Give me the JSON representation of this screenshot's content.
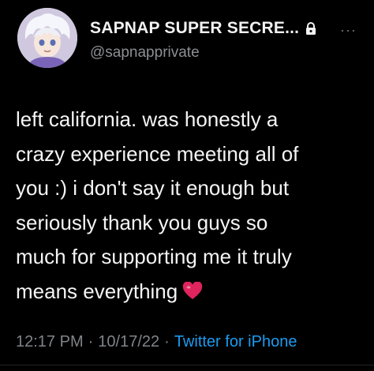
{
  "header": {
    "display_name": "SAPNAP SUPER SECRE...",
    "handle": "@sapnapprivate",
    "lock_icon": "lock-icon",
    "more_icon": "more-icon",
    "more_glyph": "···"
  },
  "tweet": {
    "text": "left california. was honestly a\ncrazy experience meeting all of\nyou :) i don't say it enough but\nseriously thank you guys so\nmuch for supporting me it truly\nmeans everything",
    "emoji": "heart-icon"
  },
  "meta": {
    "time": "12:17 PM",
    "date": "10/17/22",
    "separator": "·",
    "source": "Twitter for iPhone"
  },
  "colors": {
    "background": "#000000",
    "link": "#1d9bf0",
    "muted": "#808489",
    "heart": "#e0245e"
  }
}
